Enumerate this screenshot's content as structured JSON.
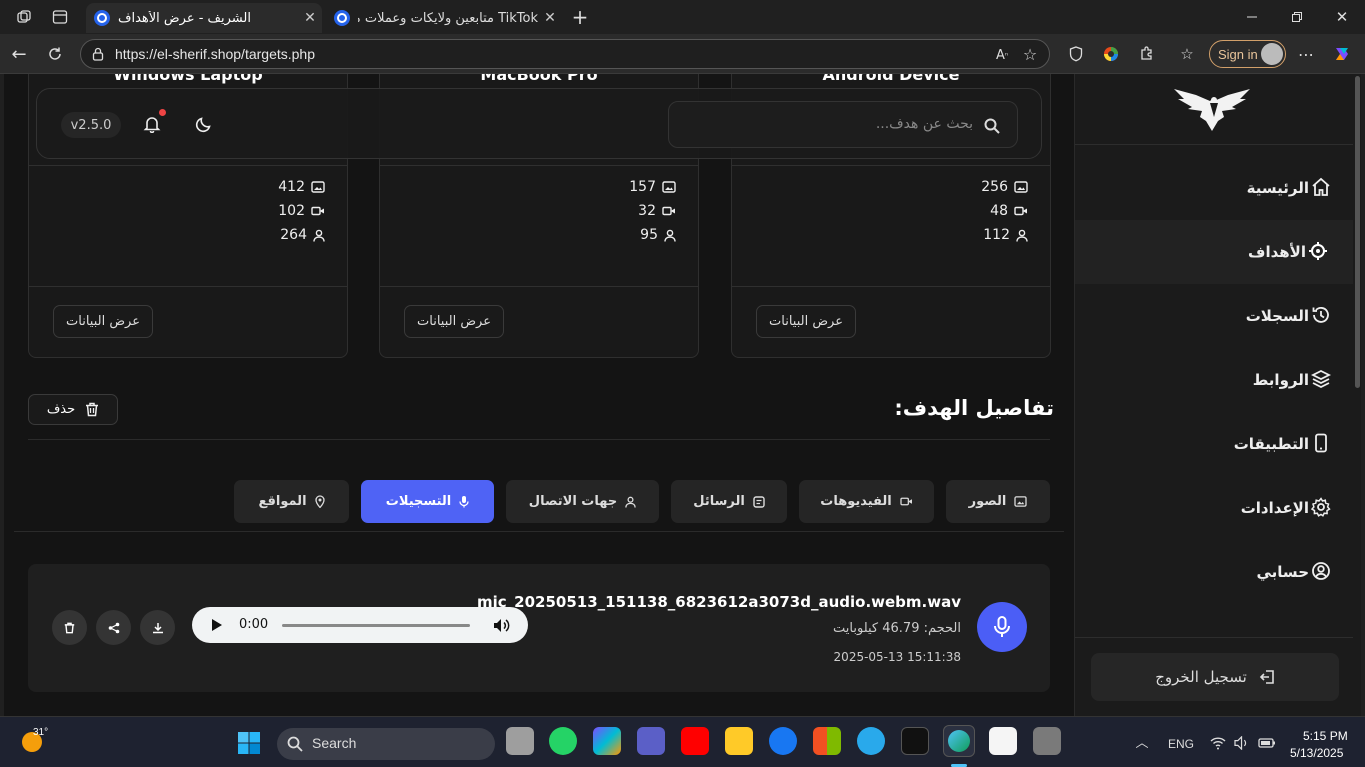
{
  "browser": {
    "tabs": [
      {
        "title": "الشريف - عرض الأهداف",
        "active": true
      },
      {
        "title": "TikTok متابعين ولايكات وعملات مجاناً",
        "active": false
      }
    ],
    "url": "https://el-sherif.shop/targets.php",
    "signin_label": "Sign in"
  },
  "header": {
    "search_placeholder": "بحث عن هدف...",
    "version": "v2.5.0"
  },
  "targets": [
    {
      "name": "Windows Laptop",
      "images": "412",
      "videos": "102",
      "contacts": "264",
      "view_label": "عرض البيانات"
    },
    {
      "name": "MacBook Pro",
      "images": "157",
      "videos": "32",
      "contacts": "95",
      "view_label": "عرض البيانات"
    },
    {
      "name": "Android Device",
      "images": "256",
      "videos": "48",
      "contacts": "112",
      "view_label": "عرض البيانات"
    }
  ],
  "details": {
    "title": "تفاصيل الهدف:",
    "delete_label": "حذف"
  },
  "tabs": [
    {
      "label": "الصور"
    },
    {
      "label": "الفيديوهات"
    },
    {
      "label": "الرسائل"
    },
    {
      "label": "جهات الاتصال"
    },
    {
      "label": "التسجيلات"
    },
    {
      "label": "المواقع"
    }
  ],
  "recording": {
    "filename": "mic_20250513_151138_6823612a3073d_audio.webm.wav",
    "size": "الحجم: 46.79 كيلوبايت",
    "date": "2025-05-13 15:11:38",
    "time": "0:00"
  },
  "sidebar": {
    "items": [
      {
        "label": "الرئيسية"
      },
      {
        "label": "الأهداف"
      },
      {
        "label": "السجلات"
      },
      {
        "label": "الروابط"
      },
      {
        "label": "التطبيقات"
      },
      {
        "label": "الإعدادات"
      },
      {
        "label": "حسابي"
      }
    ],
    "logout_label": "تسجيل الخروج"
  },
  "taskbar": {
    "temperature": "31°",
    "search_label": "Search",
    "language": "ENG",
    "time": "5:15 PM",
    "date": "5/13/2025"
  },
  "colors": {
    "accent": "#4f63f5",
    "notification": "#ef4444"
  }
}
